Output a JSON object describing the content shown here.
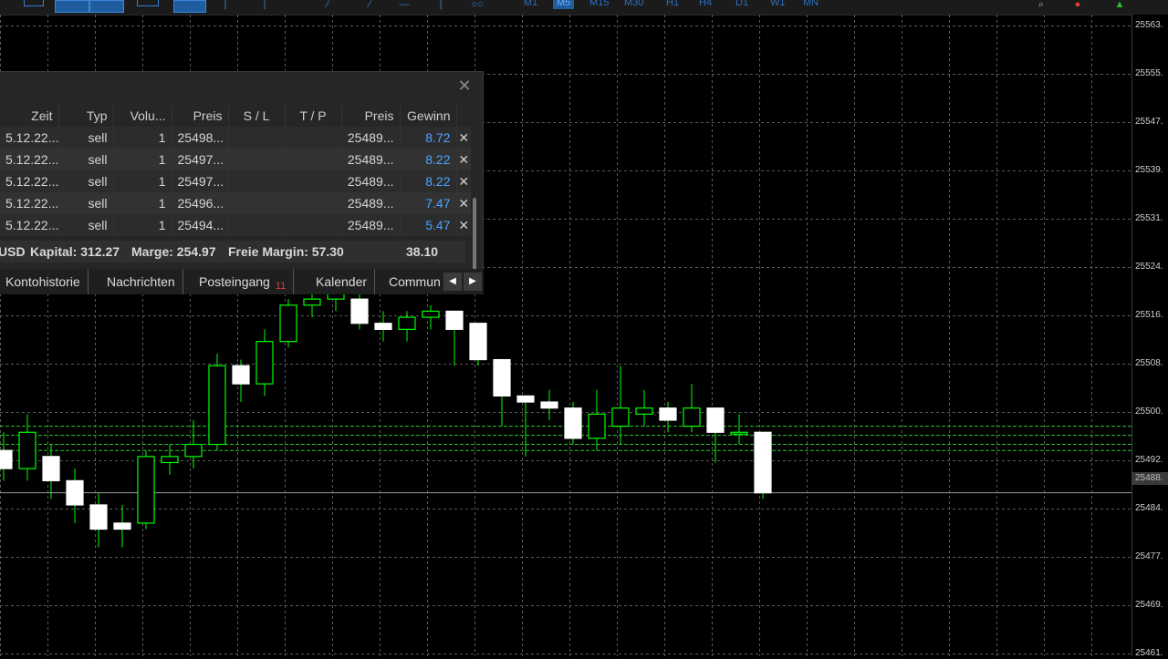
{
  "toolbar": {
    "timeframes": [
      {
        "label": "M1",
        "active": false
      },
      {
        "label": "M5",
        "active": true
      },
      {
        "label": "M15",
        "active": false
      },
      {
        "label": "M30",
        "active": false
      },
      {
        "label": "H1",
        "active": false
      },
      {
        "label": "H4",
        "active": false
      },
      {
        "label": "D1",
        "active": false
      },
      {
        "label": "W1",
        "active": false
      },
      {
        "label": "MN",
        "active": false
      }
    ]
  },
  "price_axis": {
    "labels": [
      "25563.",
      "25555.",
      "25547.",
      "25539.",
      "25531.",
      "25524.",
      "25516.",
      "25508.",
      "25500.",
      "25492.",
      "25484.",
      "25477.",
      "25469.",
      "25461."
    ],
    "current_price": "25488."
  },
  "colors": {
    "background": "#000000",
    "grid": "#2b2b2b",
    "bull_candle": "#00ff00",
    "bear_candle": "#ffffff",
    "level_lines": "#2fbf2f",
    "profit": "#4aa3ff",
    "badge": "#e23b3b"
  },
  "toolbox": {
    "columns": [
      "Zeit",
      "Typ",
      "Volu...",
      "Preis",
      "S / L",
      "T / P",
      "Preis",
      "Gewinn",
      ""
    ],
    "rows": [
      [
        "5.12.22...",
        "sell",
        "1",
        "25498...",
        "",
        "",
        "25489...",
        "8.72",
        "✕"
      ],
      [
        "5.12.22...",
        "sell",
        "1",
        "25497...",
        "",
        "",
        "25489...",
        "8.22",
        "✕"
      ],
      [
        "5.12.22...",
        "sell",
        "1",
        "25497...",
        "",
        "",
        "25489...",
        "8.22",
        "✕"
      ],
      [
        "5.12.22...",
        "sell",
        "1",
        "25496...",
        "",
        "",
        "25489...",
        "7.47",
        "✕"
      ],
      [
        "5.12.22...",
        "sell",
        "1",
        "25494...",
        "",
        "",
        "25489...",
        "5.47",
        "✕"
      ]
    ],
    "summary": {
      "currency": "USD",
      "kapital": "Kapital: 312.27",
      "marge": "Marge: 254.97",
      "freie_margin": "Freie Margin: 57.30",
      "total": "38.10"
    },
    "tabs": [
      {
        "label": "Kontohistorie"
      },
      {
        "label": "Nachrichten"
      },
      {
        "label": "Posteingang",
        "badge": "11"
      },
      {
        "label": "Kalender"
      },
      {
        "label": "Commun"
      }
    ],
    "close_symbol": "✕"
  },
  "chart_data": {
    "type": "candlestick",
    "symbol_timeframe": "M5",
    "ylim": [
      25461,
      25567
    ],
    "grid": true,
    "current_price": 25488,
    "level_lines": [
      25499,
      25497.5,
      25496,
      25495
    ],
    "candles": [
      {
        "o": 25495,
        "h": 25498,
        "l": 25490,
        "c": 25492
      },
      {
        "o": 25492,
        "h": 25501,
        "l": 25490,
        "c": 25498
      },
      {
        "o": 25494,
        "h": 25496,
        "l": 25487,
        "c": 25490
      },
      {
        "o": 25490,
        "h": 25492,
        "l": 25483,
        "c": 25486
      },
      {
        "o": 25486,
        "h": 25488,
        "l": 25479,
        "c": 25482
      },
      {
        "o": 25483,
        "h": 25486,
        "l": 25479,
        "c": 25482
      },
      {
        "o": 25483,
        "h": 25495,
        "l": 25482,
        "c": 25494
      },
      {
        "o": 25493,
        "h": 25496,
        "l": 25491,
        "c": 25494
      },
      {
        "o": 25494,
        "h": 25500,
        "l": 25492,
        "c": 25496
      },
      {
        "o": 25496,
        "h": 25511,
        "l": 25495,
        "c": 25509
      },
      {
        "o": 25509,
        "h": 25510,
        "l": 25503,
        "c": 25506
      },
      {
        "o": 25506,
        "h": 25515,
        "l": 25504,
        "c": 25513
      },
      {
        "o": 25513,
        "h": 25520,
        "l": 25512,
        "c": 25519
      },
      {
        "o": 25519,
        "h": 25521,
        "l": 25517,
        "c": 25520
      },
      {
        "o": 25520,
        "h": 25522,
        "l": 25518,
        "c": 25521
      },
      {
        "o": 25520,
        "h": 25521,
        "l": 25515,
        "c": 25516
      },
      {
        "o": 25516,
        "h": 25518,
        "l": 25513,
        "c": 25515
      },
      {
        "o": 25515,
        "h": 25518,
        "l": 25513,
        "c": 25517
      },
      {
        "o": 25517,
        "h": 25519,
        "l": 25515,
        "c": 25518
      },
      {
        "o": 25518,
        "h": 25518,
        "l": 25509,
        "c": 25515
      },
      {
        "o": 25516,
        "h": 25516,
        "l": 25509,
        "c": 25510
      },
      {
        "o": 25510,
        "h": 25510,
        "l": 25499,
        "c": 25504
      },
      {
        "o": 25504,
        "h": 25504,
        "l": 25494,
        "c": 25503
      },
      {
        "o": 25503,
        "h": 25505,
        "l": 25500,
        "c": 25502
      },
      {
        "o": 25502,
        "h": 25503,
        "l": 25496,
        "c": 25497
      },
      {
        "o": 25497,
        "h": 25505,
        "l": 25495,
        "c": 25501
      },
      {
        "o": 25499,
        "h": 25509,
        "l": 25496,
        "c": 25502
      },
      {
        "o": 25501,
        "h": 25505,
        "l": 25499,
        "c": 25502
      },
      {
        "o": 25502,
        "h": 25503,
        "l": 25498,
        "c": 25500
      },
      {
        "o": 25499,
        "h": 25506,
        "l": 25498,
        "c": 25502
      },
      {
        "o": 25502,
        "h": 25502,
        "l": 25493,
        "c": 25498
      },
      {
        "o": 25498,
        "h": 25501,
        "l": 25496,
        "c": 25498
      },
      {
        "o": 25498,
        "h": 25498,
        "l": 25487,
        "c": 25488
      }
    ]
  }
}
